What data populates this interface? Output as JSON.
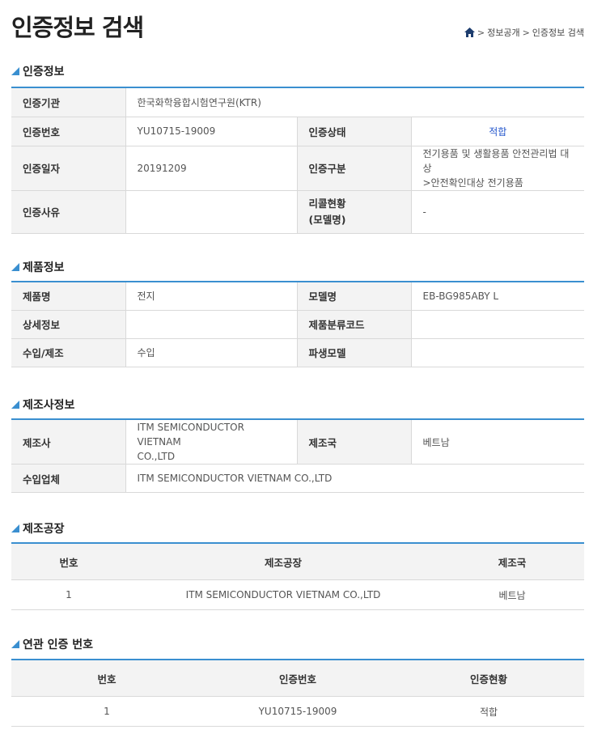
{
  "page_title": "인증정보 검색",
  "breadcrumb": {
    "items": [
      "정보공개",
      "인증정보 검색"
    ],
    "separator": ">"
  },
  "colors": {
    "accent": "#3a8fd0",
    "status_ok": "#2255cc",
    "header_bg": "#f3f3f3"
  },
  "cert_info": {
    "title": "인증정보",
    "agency_label": "인증기관",
    "agency_value": "한국화학융합시험연구원(KTR)",
    "number_label": "인증번호",
    "number_value": "YU10715-19009",
    "status_label": "인증상태",
    "status_value": "적합",
    "date_label": "인증일자",
    "date_value": "20191209",
    "category_label": "인증구분",
    "category_value_1": "전기용품 및 생활용품 안전관리법 대상",
    "category_value_2": ">안전확인대상 전기용품",
    "reason_label": "인증사유",
    "reason_value": "",
    "recall_label_1": "리콜현황",
    "recall_label_2": "(모델명)",
    "recall_value": "-"
  },
  "product_info": {
    "title": "제품정보",
    "name_label": "제품명",
    "name_value": "전지",
    "model_label": "모델명",
    "model_value": "EB-BG985ABY L",
    "detail_label": "상세정보",
    "detail_value": "",
    "class_code_label": "제품분류코드",
    "class_code_value": "",
    "import_label": "수입/제조",
    "import_value": "수입",
    "derived_label": "파생모델",
    "derived_value": ""
  },
  "manufacturer_info": {
    "title": "제조사정보",
    "maker_label": "제조사",
    "maker_value_1": "ITM SEMICONDUCTOR VIETNAM",
    "maker_value_2": "CO.,LTD",
    "country_label": "제조국",
    "country_value": "베트남",
    "importer_label": "수입업체",
    "importer_value": "ITM SEMICONDUCTOR VIETNAM CO.,LTD"
  },
  "factory": {
    "title": "제조공장",
    "headers": [
      "번호",
      "제조공장",
      "제조국"
    ],
    "rows": [
      {
        "no": "1",
        "factory": "ITM SEMICONDUCTOR VIETNAM CO.,LTD",
        "country": "베트남"
      }
    ]
  },
  "related": {
    "title": "연관 인증 번호",
    "headers": [
      "번호",
      "인증번호",
      "인증현황"
    ],
    "rows": [
      {
        "no": "1",
        "number": "YU10715-19009",
        "status": "적합"
      }
    ]
  }
}
